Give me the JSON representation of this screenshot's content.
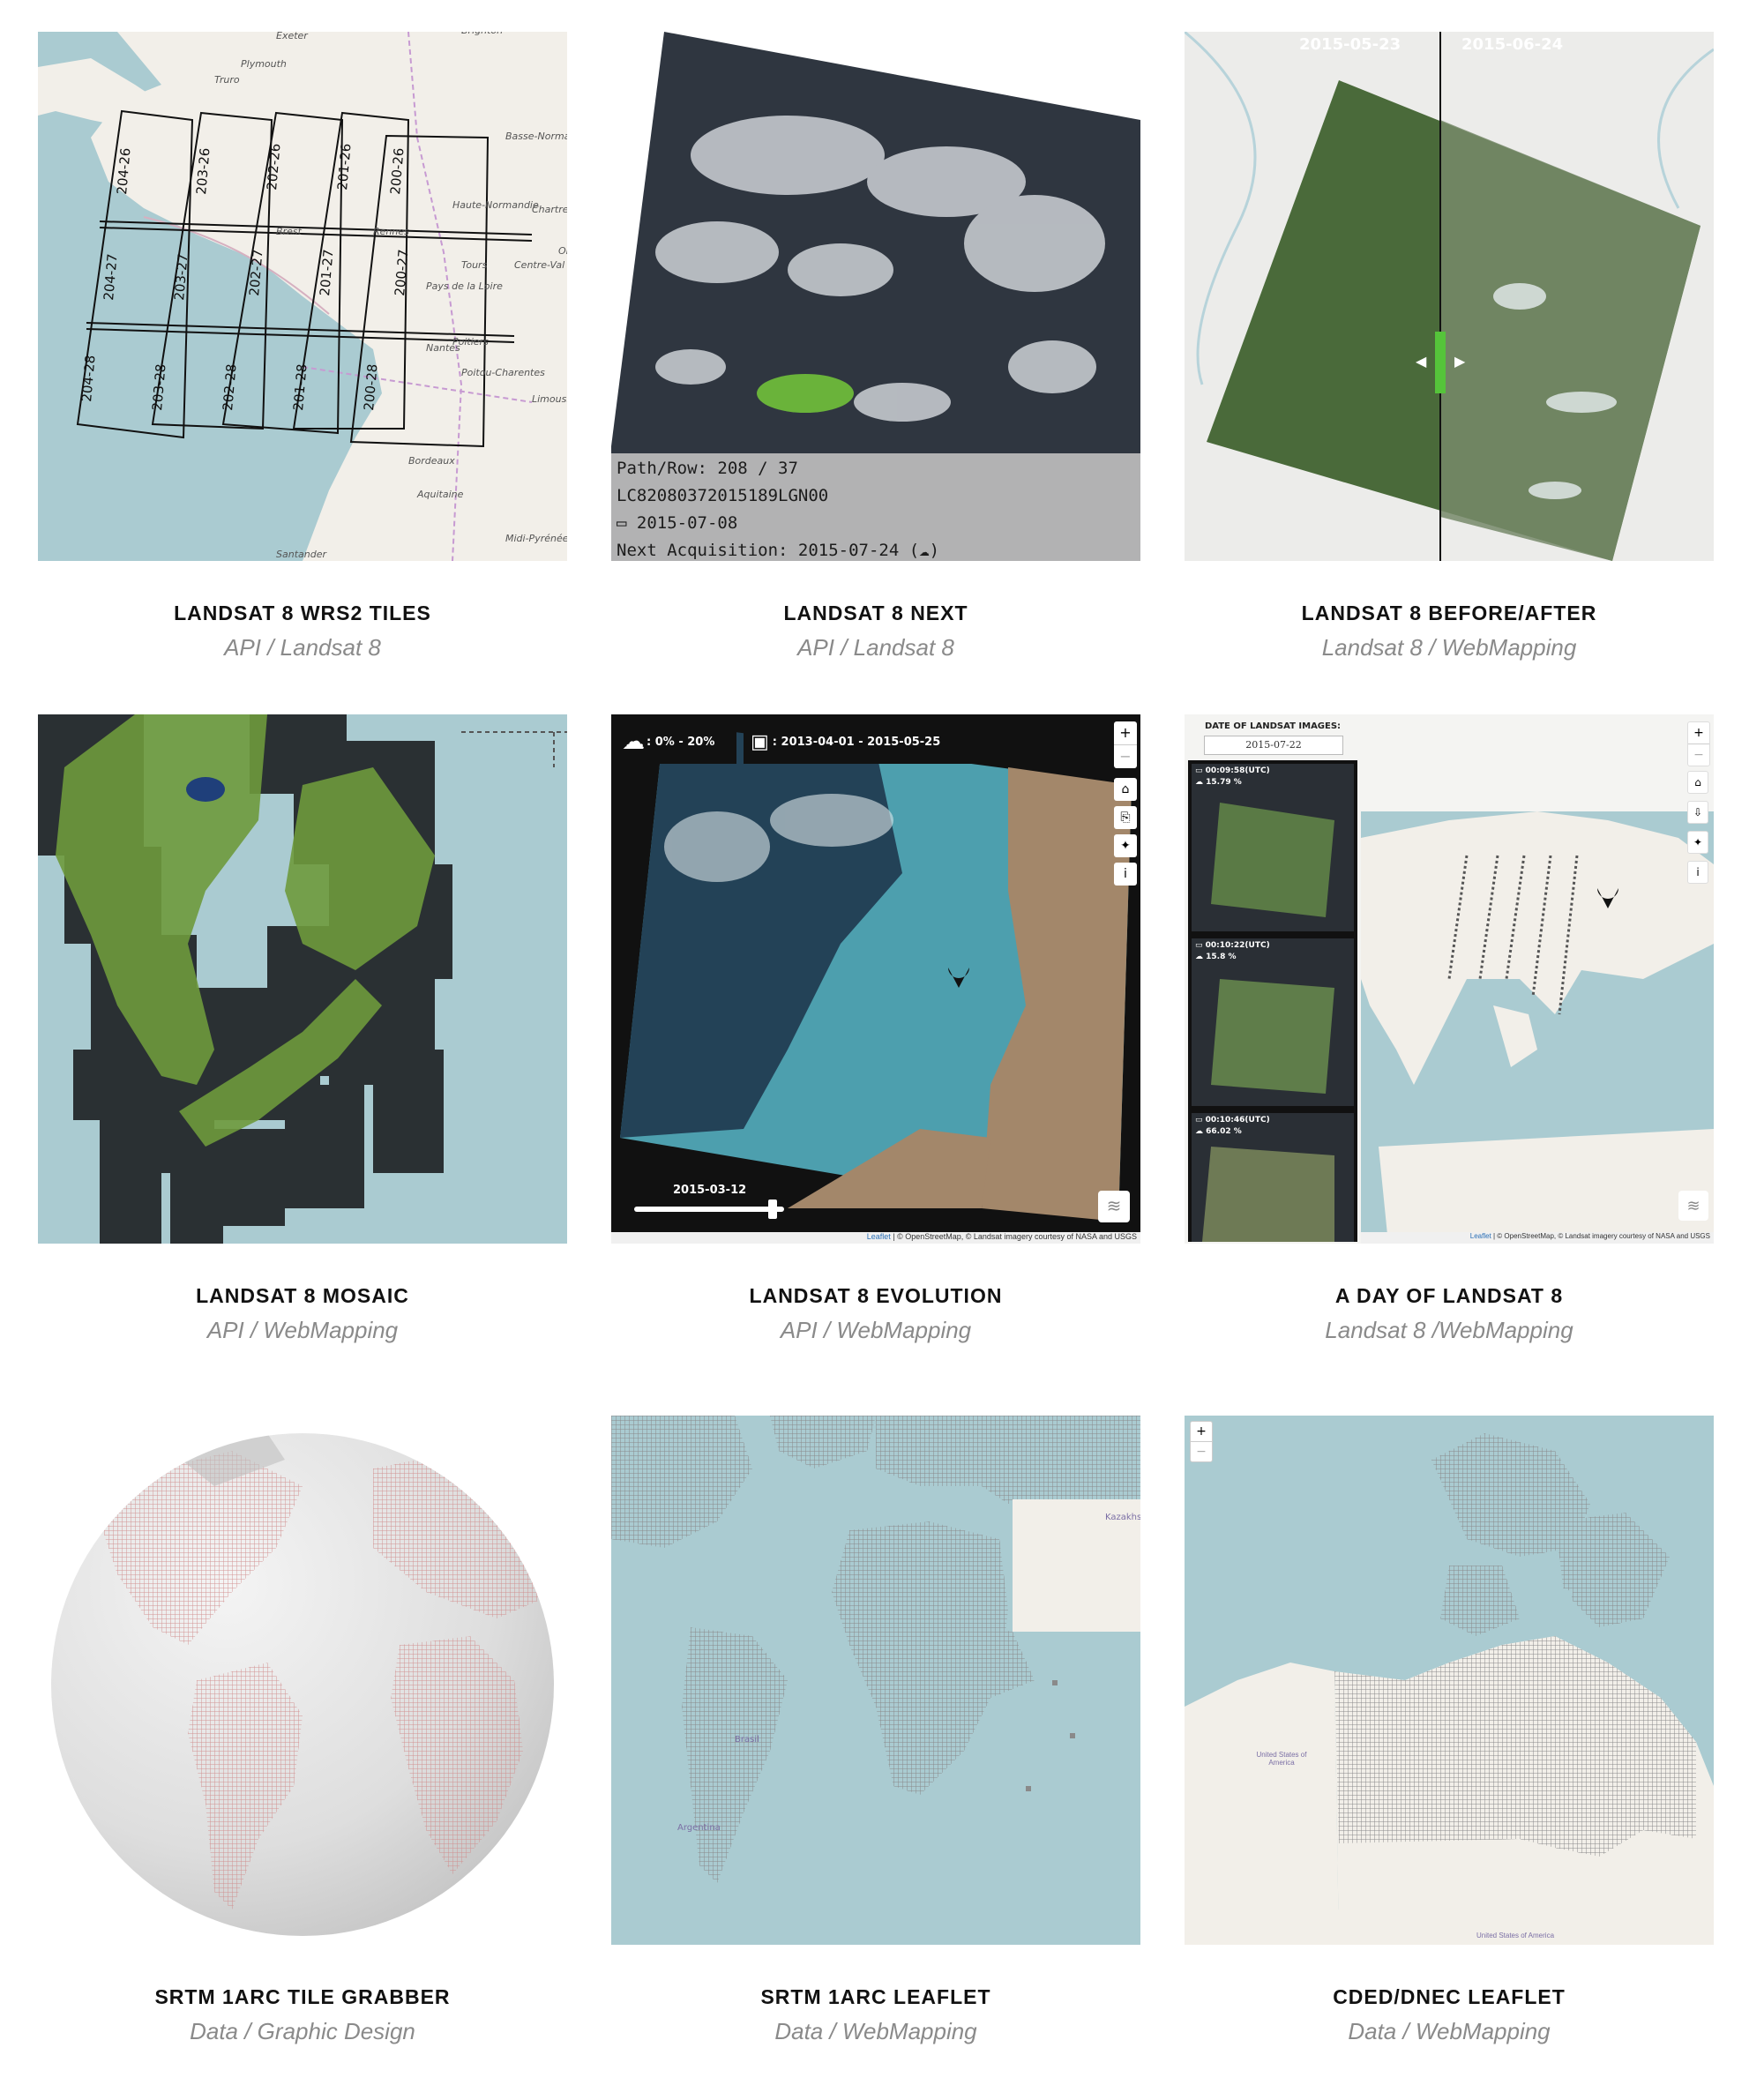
{
  "colors": {
    "ocean": "#aacbd1",
    "land": "#f2efe9",
    "grid": "#8e8e8e",
    "title": "#111111",
    "subtitle": "#8a8a8a",
    "green_handle": "#55c43a"
  },
  "cards": [
    {
      "title": "LANDSAT 8 WRS2 TILES",
      "subtitle": "API / Landsat 8",
      "tile_labels": [
        "204-26",
        "203-26",
        "202-26",
        "201-26",
        "200-26",
        "204-27",
        "203-27",
        "202-27",
        "201-27",
        "200-27",
        "204-28",
        "203-28",
        "202-28",
        "201-28",
        "200-28"
      ],
      "map_labels": [
        "Exeter",
        "Plymouth",
        "Truro",
        "Brighton",
        "Basse-Normandie",
        "Chartres",
        "Orléan",
        "Pays de la Loire",
        "Centre-Val de Loire",
        "Poitiers",
        "Poitou-Charentes",
        "Limousin",
        "Bordeaux",
        "Aquitaine",
        "Midi-Pyrénées",
        "Santander",
        "Rennes",
        "Brest",
        "Nantes",
        "Tours",
        "Haute-Normandie"
      ]
    },
    {
      "title": "LANDSAT 8 NEXT",
      "subtitle": "API / Landsat 8",
      "info": {
        "path_row": "Path/Row: 208 / 37",
        "scene_id": "LC82080372015189LGN00",
        "date": "2015-07-08",
        "next": "Next Acquisition: 2015-07-24"
      },
      "icons": [
        "calendar-icon",
        "cloud-icon"
      ]
    },
    {
      "title": "LANDSAT 8 BEFORE/AFTER",
      "subtitle": "Landsat 8 / WebMapping",
      "date_left": "2015-05-23",
      "date_right": "2015-06-24"
    },
    {
      "title": "LANDSAT 8 MOSAIC",
      "subtitle": "API / WebMapping"
    },
    {
      "title": "LANDSAT 8 EVOLUTION",
      "subtitle": "API / WebMapping",
      "cloud_filter": ": 0% - 20%",
      "date_range": ": 2013-04-01 - 2015-05-25",
      "slider_date": "2015-03-12",
      "attribution_link": "Leaflet",
      "attribution": " | © OpenStreetMap, © Landsat imagery courtesy of NASA and USGS",
      "controls": [
        "+",
        "−"
      ]
    },
    {
      "title": "A DAY OF LANDSAT 8",
      "subtitle": "Landsat 8 /WebMapping",
      "panel_title": "DATE OF LANDSAT IMAGES:",
      "panel_date": "2015-07-22",
      "scenes": [
        {
          "time": "00:09:58(UTC)",
          "cloud": "15.79 %"
        },
        {
          "time": "00:10:22(UTC)",
          "cloud": "15.8 %"
        },
        {
          "time": "00:10:46(UTC)",
          "cloud": "66.02 %"
        }
      ],
      "attribution_link": "Leaflet",
      "attribution": " | © OpenStreetMap, © Landsat imagery courtesy of NASA and USGS",
      "controls": [
        "+",
        "−"
      ]
    },
    {
      "title": "SRTM 1ARC TILE GRABBER",
      "subtitle": "Data / Graphic Design"
    },
    {
      "title": "SRTM 1ARC LEAFLET",
      "subtitle": "Data / WebMapping",
      "map_labels": [
        "Kazakhst",
        "Brasil",
        "Argentina"
      ]
    },
    {
      "title": "CDED/DNEC LEAFLET",
      "subtitle": "Data / WebMapping",
      "controls": [
        "+",
        "−"
      ],
      "map_labels": [
        "United States of America",
        "United States of America"
      ]
    }
  ]
}
